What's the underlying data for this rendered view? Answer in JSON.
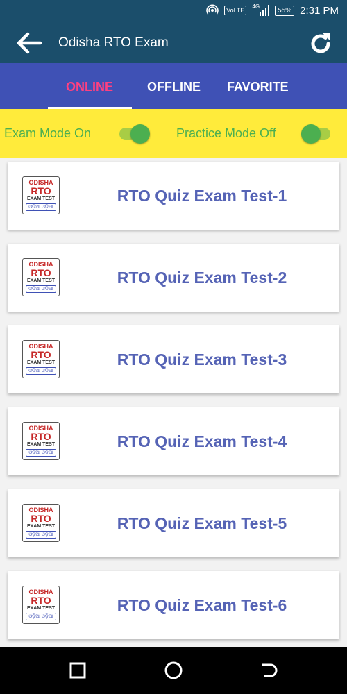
{
  "status_bar": {
    "volte": "VoLTE",
    "signal": "4G",
    "battery": "55%",
    "time": "2:31 PM"
  },
  "app_bar": {
    "title": "Odisha RTO Exam",
    "back_icon": "arrow-left-icon",
    "refresh_icon": "refresh-icon"
  },
  "tabs": [
    {
      "label": "ONLINE",
      "active": true
    },
    {
      "label": "OFFLINE",
      "active": false
    },
    {
      "label": "FAVORITE",
      "active": false
    }
  ],
  "modes": {
    "exam_label": "Exam Mode On",
    "exam_on": true,
    "practice_label": "Practice Mode Off",
    "practice_on": false
  },
  "logo": {
    "line1": "ODISHA",
    "line2": "RTO",
    "line3": "EXAM TEST",
    "line4": "ଓଡ଼ିଆ ଓଡ଼ିଆ"
  },
  "tests": [
    {
      "title": "RTO Quiz Exam Test-1"
    },
    {
      "title": "RTO Quiz Exam Test-2"
    },
    {
      "title": "RTO Quiz Exam Test-3"
    },
    {
      "title": "RTO Quiz Exam Test-4"
    },
    {
      "title": "RTO Quiz Exam Test-5"
    },
    {
      "title": "RTO Quiz Exam Test-6"
    }
  ],
  "colors": {
    "app_bar": "#1b4e6b",
    "tab_bar": "#3f51b5",
    "active_tab": "#ff4081",
    "mode_bar": "#ffeb3b",
    "switch": "#4caf50",
    "card_title": "#5563b5",
    "logo_red": "#c62828"
  },
  "nav_bar": {
    "back_icon": "square-icon",
    "home_icon": "circle-icon",
    "recents_icon": "back-arrow-icon"
  }
}
